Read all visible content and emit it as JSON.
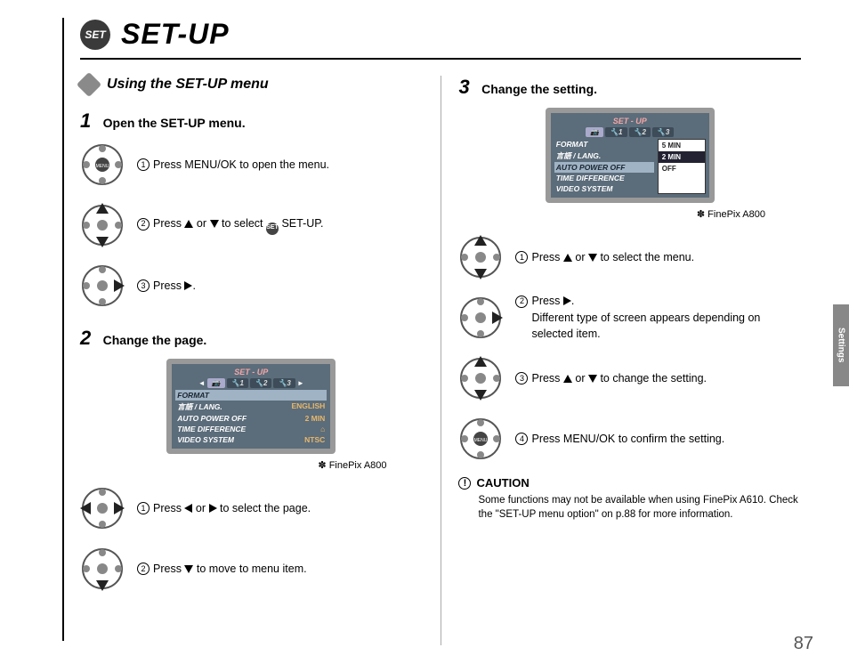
{
  "header": {
    "badge": "SET",
    "title": "SET-UP"
  },
  "section": {
    "heading": "Using the SET-UP menu"
  },
  "caption_prefix": "✽",
  "caption_model": "FinePix A800",
  "step1": {
    "num": "1",
    "title": "Open the SET-UP menu.",
    "i1": "Press MENU/OK to open the menu.",
    "i2a": "Press ",
    "i2b": " or ",
    "i2c": " to select ",
    "i2d": " SET-UP.",
    "i3a": "Press ",
    "i3b": ".",
    "set_inline": "SET"
  },
  "step2": {
    "num": "2",
    "title": "Change the page.",
    "i1a": "Press ",
    "i1b": " or ",
    "i1c": " to select the page.",
    "i2a": "Press ",
    "i2b": " to move to menu item."
  },
  "step3": {
    "num": "3",
    "title": "Change the setting.",
    "i1a": "Press ",
    "i1b": " or ",
    "i1c": " to select the menu.",
    "i2a": "Press ",
    "i2b": ".",
    "i2c": "Different type of screen appears depending on selected item.",
    "i3a": "Press ",
    "i3b": " or ",
    "i3c": " to change the setting.",
    "i4": "Press MENU/OK to confirm the setting."
  },
  "lcd_a": {
    "title": "SET - UP",
    "tabs": [
      "📷",
      "🔧1",
      "🔧2",
      "🔧3"
    ],
    "rows": [
      {
        "label": "FORMAT",
        "val": ""
      },
      {
        "label": "言語 / LANG.",
        "val": "ENGLISH"
      },
      {
        "label": "AUTO POWER OFF",
        "val": "2  MIN"
      },
      {
        "label": "TIME DIFFERENCE",
        "val": "⌂"
      },
      {
        "label": "VIDEO SYSTEM",
        "val": "NTSC"
      }
    ]
  },
  "lcd_b": {
    "title": "SET - UP",
    "tabs": [
      "📷",
      "🔧1",
      "🔧2",
      "🔧3"
    ],
    "rows": [
      "FORMAT",
      "言語 / LANG.",
      "AUTO POWER OFF",
      "TIME DIFFERENCE",
      "VIDEO SYSTEM"
    ],
    "popup": [
      "5 MIN",
      "2 MIN",
      "OFF"
    ]
  },
  "caution": {
    "title": "CAUTION",
    "body": "Some functions may not be available when using FinePix A610. Check the \"SET-UP menu option\" on p.88 for more information."
  },
  "page_number": "87",
  "side_tab": "Settings"
}
